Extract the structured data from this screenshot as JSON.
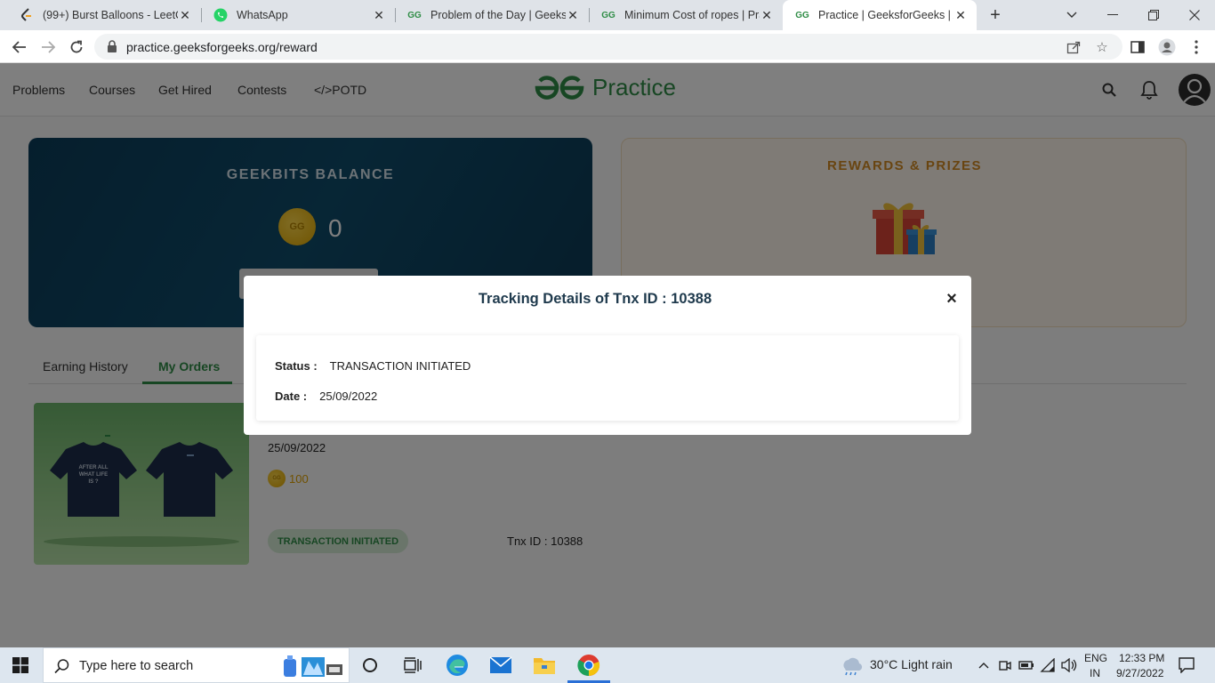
{
  "browser": {
    "tabs": [
      {
        "title": "(99+) Burst Balloons - LeetCo",
        "icon": "leetcode-icon"
      },
      {
        "title": "WhatsApp",
        "icon": "whatsapp-icon"
      },
      {
        "title": "Problem of the Day | Geeksfo",
        "icon": "gfg-icon"
      },
      {
        "title": "Minimum Cost of ropes | Pra",
        "icon": "gfg-icon"
      },
      {
        "title": "Practice | GeeksforGeeks | A c",
        "icon": "gfg-icon"
      }
    ],
    "url": "practice.geeksforgeeks.org/reward"
  },
  "site": {
    "nav": {
      "problems": "Problems",
      "courses": "Courses",
      "get_hired": "Get Hired",
      "contests": "Contests",
      "potd": "</>POTD"
    },
    "logo_text": "Practice"
  },
  "balance": {
    "title": "GEEKBITS BALANCE",
    "value": "0"
  },
  "rewards": {
    "title": "REWARDS & PRIZES"
  },
  "page_tabs": {
    "earning_history": "Earning History",
    "my_orders": "My Orders"
  },
  "order": {
    "date": "25/09/2022",
    "coins": "100",
    "status": "TRANSACTION INITIATED",
    "tnx": "Tnx ID : 10388"
  },
  "modal": {
    "title": "Tracking Details of Tnx ID : 10388",
    "close": "×",
    "status_label": "Status :",
    "status_value": "TRANSACTION INITIATED",
    "date_label": "Date :",
    "date_value": "25/09/2022"
  },
  "taskbar": {
    "search_placeholder": "Type here to search",
    "weather": "30°C  Light rain",
    "lang_top": "ENG",
    "lang_bottom": "IN",
    "time": "12:33 PM",
    "date": "9/27/2022"
  },
  "colors": {
    "gfg_green": "#2f8d46",
    "balance_card": "#0b3d5a",
    "rewards_title": "#d38b23"
  }
}
